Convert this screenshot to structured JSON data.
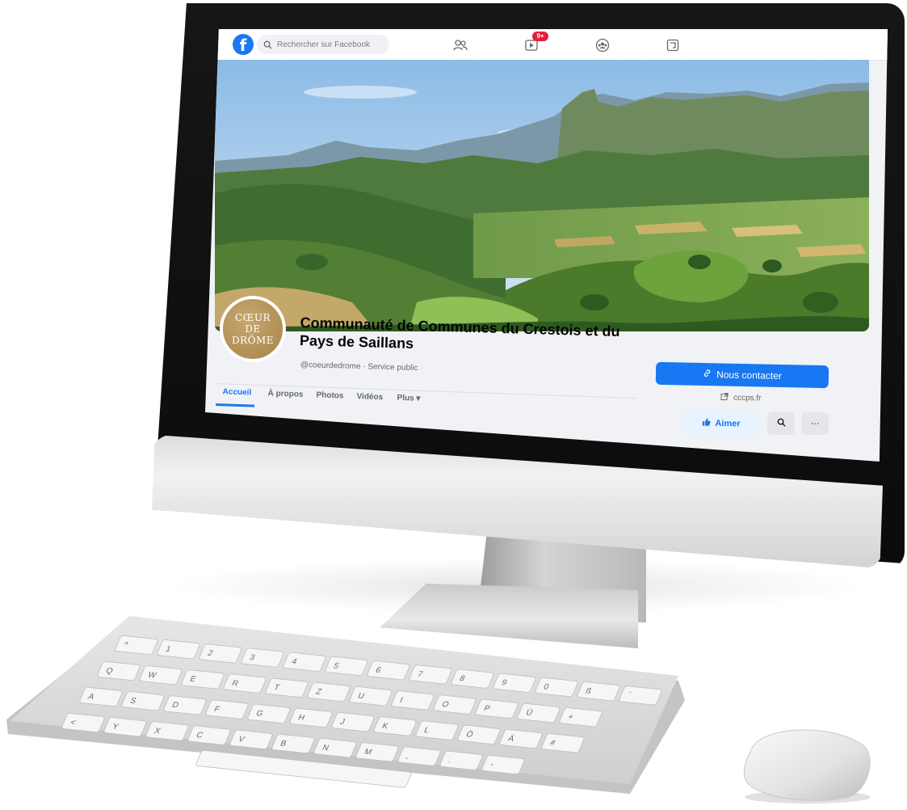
{
  "facebook": {
    "search_placeholder": "Rechercher sur Facebook",
    "notification_badge": "9+",
    "page_name": "Communauté de Communes du Crestois et du Pays de Saillans",
    "page_subtitle": "@coeurdedrome · Service public",
    "avatar_lines": [
      "CŒUR",
      "DE",
      "DRÔME"
    ],
    "contact_button": "Nous contacter",
    "website": "cccps.fr",
    "tabs": [
      "Accueil",
      "À propos",
      "Photos",
      "Vidéos",
      "Plus ▾"
    ],
    "like_button": "Aimer",
    "more_button": "···"
  },
  "keyboard": {
    "letter_rows": [
      [
        "^",
        "1",
        "2",
        "3",
        "4",
        "5",
        "6",
        "7",
        "8",
        "9",
        "0",
        "ß",
        "´"
      ],
      [
        "Q",
        "W",
        "E",
        "R",
        "T",
        "Z",
        "U",
        "I",
        "O",
        "P",
        "Ü",
        "+"
      ],
      [
        "A",
        "S",
        "D",
        "F",
        "G",
        "H",
        "J",
        "K",
        "L",
        "Ö",
        "Ä",
        "#"
      ],
      [
        "<",
        "Y",
        "X",
        "C",
        "V",
        "B",
        "N",
        "M",
        ",",
        ".",
        "-"
      ]
    ]
  },
  "colors": {
    "facebook_blue": "#1877f2",
    "badge_red": "#e41e3f",
    "avatar_gold": "#b08f55",
    "bezel": "#111111",
    "aluminum": "#d8d8d8"
  }
}
